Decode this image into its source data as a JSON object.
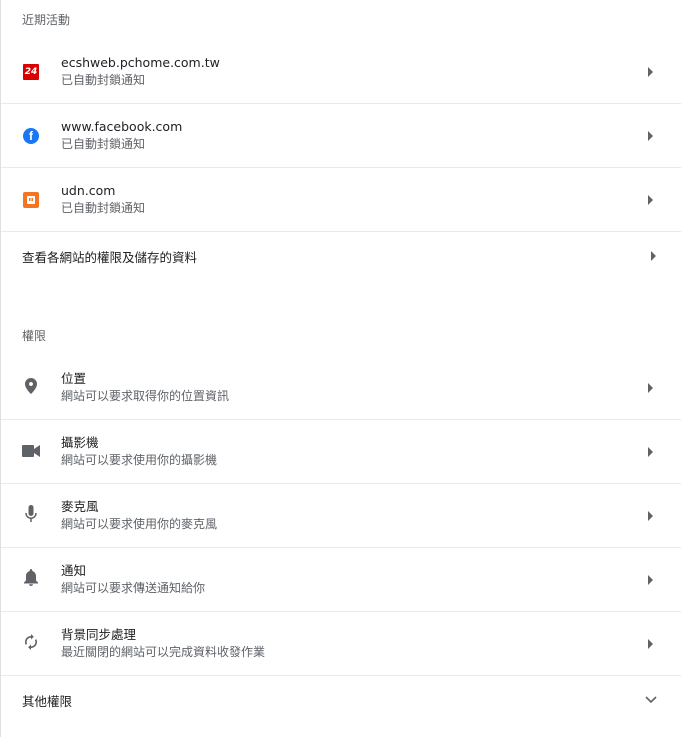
{
  "recent": {
    "title": "近期活動",
    "items": [
      {
        "site": "ecshweb.pchome.com.tw",
        "status": "已自動封鎖通知",
        "icon": "pchome-24-icon"
      },
      {
        "site": "www.facebook.com",
        "status": "已自動封鎖通知",
        "icon": "facebook-icon"
      },
      {
        "site": "udn.com",
        "status": "已自動封鎖通知",
        "icon": "udn-icon"
      }
    ],
    "view_all_label": "查看各網站的權限及儲存的資料"
  },
  "permissions": {
    "title": "權限",
    "items": [
      {
        "title": "位置",
        "desc": "網站可以要求取得你的位置資訊",
        "icon": "location-pin-icon"
      },
      {
        "title": "攝影機",
        "desc": "網站可以要求使用你的攝影機",
        "icon": "camera-icon"
      },
      {
        "title": "麥克風",
        "desc": "網站可以要求使用你的麥克風",
        "icon": "microphone-icon"
      },
      {
        "title": "通知",
        "desc": "網站可以要求傳送通知給你",
        "icon": "bell-icon"
      },
      {
        "title": "背景同步處理",
        "desc": "最近關閉的網站可以完成資料收發作業",
        "icon": "sync-icon"
      }
    ],
    "more_label": "其他權限"
  },
  "colors": {
    "accent": "#1a73e8",
    "icon_grey": "#5f6368",
    "divider": "#e8eaed"
  }
}
